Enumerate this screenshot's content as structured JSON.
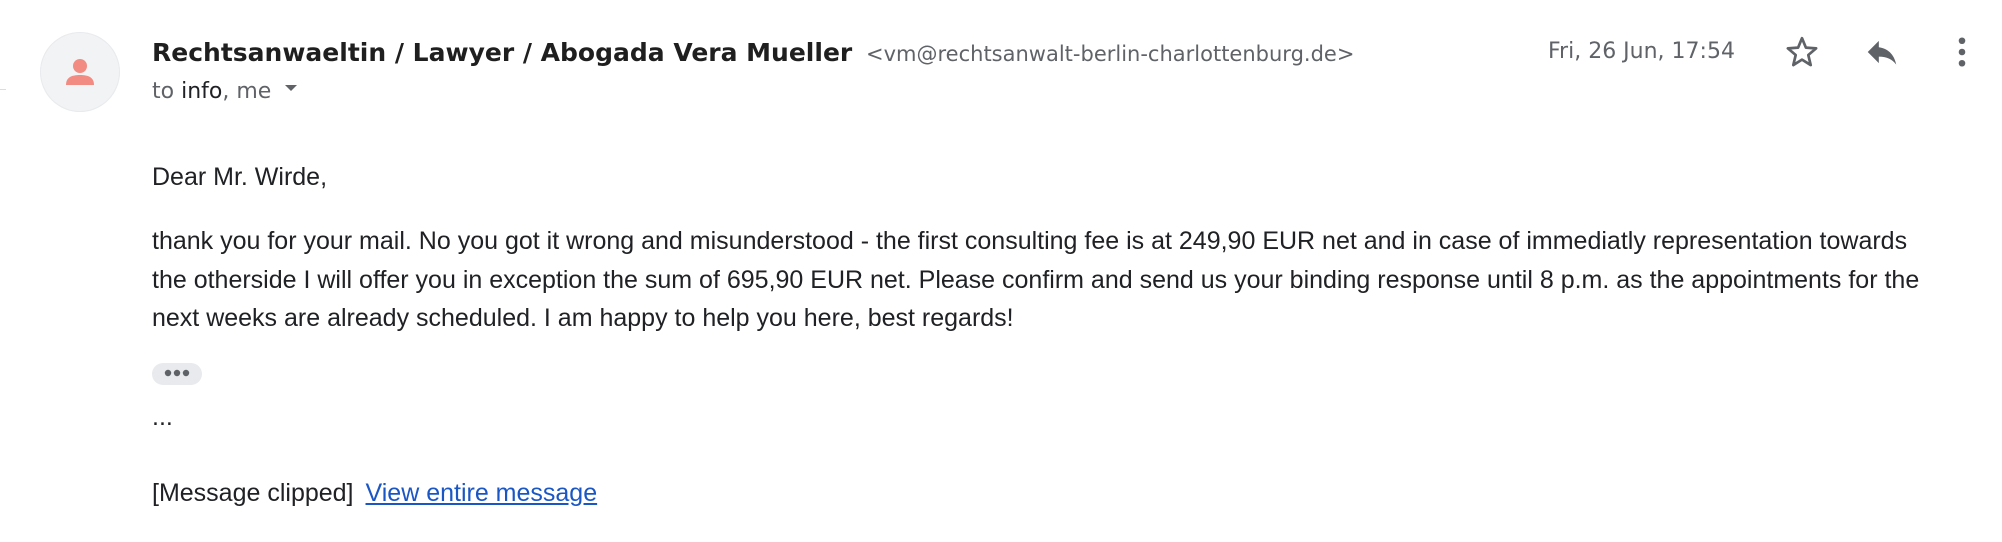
{
  "sender": {
    "name": "Rechtsanwaeltin / Lawyer / Abogada Vera Mueller",
    "email": "<vm@rechtsanwalt-berlin-charlottenburg.de>",
    "avatar_icon": "person-icon",
    "avatar_color": "#f28b82"
  },
  "recipients": {
    "prefix": "to",
    "primary": "info",
    "separator": ",",
    "secondary": "me",
    "toggle_icon": "chevron-down-icon"
  },
  "date": "Fri, 26 Jun, 17:54",
  "actions": {
    "star_icon": "star-icon",
    "reply_icon": "reply-icon",
    "more_icon": "more-vert-icon"
  },
  "body": {
    "greeting": "Dear Mr. Wirde,",
    "paragraph": "thank you for your mail. No you got it wrong and misunderstood - the first consulting fee is at 249,90 EUR net and in case of immediatly representation towards the otherside I will offer you in exception the sum of 695,90 EUR net. Please confirm and send us your binding response until 8 p.m. as the appointments for the next weeks are already scheduled. I am happy to help you here, best regards!",
    "trimmed_icon": "ellipsis-icon",
    "ellipsis": "...",
    "clipped_text": "[Message clipped]",
    "view_entire_link": "View entire message"
  },
  "colors": {
    "link": "#1a57c5",
    "secondary_text": "#5f6368",
    "icon": "#5f6368"
  }
}
